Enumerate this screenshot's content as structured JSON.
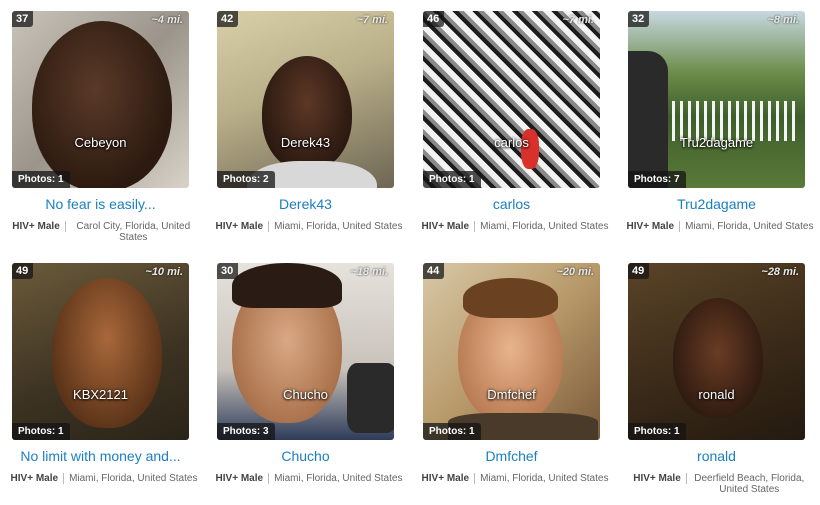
{
  "profiles": [
    {
      "age": "37",
      "distance": "~4 mi.",
      "name": "Cebeyon",
      "photos": "Photos: 1",
      "headline": "No fear is easily...",
      "status": "HIV+ Male",
      "location": "Carol City, Florida, United States"
    },
    {
      "age": "42",
      "distance": "~7 mi.",
      "name": "Derek43",
      "photos": "Photos: 2",
      "headline": "Derek43",
      "status": "HIV+ Male",
      "location": "Miami, Florida, United States"
    },
    {
      "age": "46",
      "distance": "~7 mi.",
      "name": "carlos",
      "photos": "Photos: 1",
      "headline": "carlos",
      "status": "HIV+ Male",
      "location": "Miami, Florida, United States"
    },
    {
      "age": "32",
      "distance": "~8 mi.",
      "name": "Tru2dagame",
      "photos": "Photos: 7",
      "headline": "Tru2dagame",
      "status": "HIV+ Male",
      "location": "Miami, Florida, United States"
    },
    {
      "age": "49",
      "distance": "~10 mi.",
      "name": "KBX2121",
      "photos": "Photos: 1",
      "headline": "No limit with money and...",
      "status": "HIV+ Male",
      "location": "Miami, Florida, United States"
    },
    {
      "age": "30",
      "distance": "~18 mi.",
      "name": "Chucho",
      "photos": "Photos: 3",
      "headline": "Chucho",
      "status": "HIV+ Male",
      "location": "Miami, Florida, United States"
    },
    {
      "age": "44",
      "distance": "~20 mi.",
      "name": "Dmfchef",
      "photos": "Photos: 1",
      "headline": "Dmfchef",
      "status": "HIV+ Male",
      "location": "Miami, Florida, United States"
    },
    {
      "age": "49",
      "distance": "~28 mi.",
      "name": "ronald",
      "photos": "Photos: 1",
      "headline": "ronald",
      "status": "HIV+ Male",
      "location": "Deerfield Beach, Florida, United States"
    }
  ],
  "colors": {
    "link": "#1a7fc1",
    "badge_bg": "#141414"
  }
}
